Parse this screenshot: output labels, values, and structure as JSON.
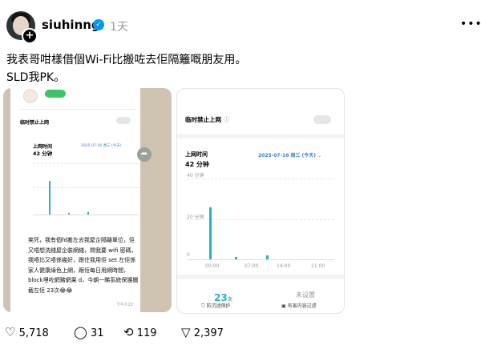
{
  "post": {
    "username": "siuhinng",
    "time": "1天",
    "caption_line1": "我表哥咁樣借個Wi-Fi比搬咗去佢隔籬嘅朋友用。",
    "caption_line2": "SLD我PK。"
  },
  "screenshot_right": {
    "toggle_label": "临时禁止上网",
    "online_time_label": "上网时间",
    "online_time_value": "42 分钟",
    "date_label": "2025-07-16 周三 (今天)",
    "y_ticks": [
      "40 分钟",
      "20 分钟",
      "0"
    ],
    "x_ticks": [
      "00:00",
      "07:00",
      "14:00",
      "21:00"
    ],
    "blocked_count": "23",
    "blocked_unit": "次",
    "blocked_label": "防沉迷保护",
    "not_set_value": "未设置",
    "not_set_label": "有害内容过滤"
  },
  "screenshot_left": {
    "toggle_label": "临时禁止上网",
    "online_time_label": "上网时间",
    "online_time_value": "42 分钟",
    "date_label": "2025-07-16 周三 (今天)",
    "message_text": "笑死，我有個fd搬左去我屋企隔離單位，佢又唔想洗錢屋企裝網綫，問我要 wifi 密碼，我唔比又唔係幾好，跟住我用佢 set 左佢係家人健康綠色上網，跟佢每日用網時間，block埋咗網豬網果 d，今朝一睇系統保護攔截左佢 23次😂😂",
    "message_time": "下午3:22"
  },
  "actions": {
    "likes": "5,718",
    "comments": "31",
    "reposts": "119",
    "shares": "2,397"
  },
  "colors": {
    "accent_teal": "#27b3bd",
    "verified_blue": "#0095f6"
  }
}
